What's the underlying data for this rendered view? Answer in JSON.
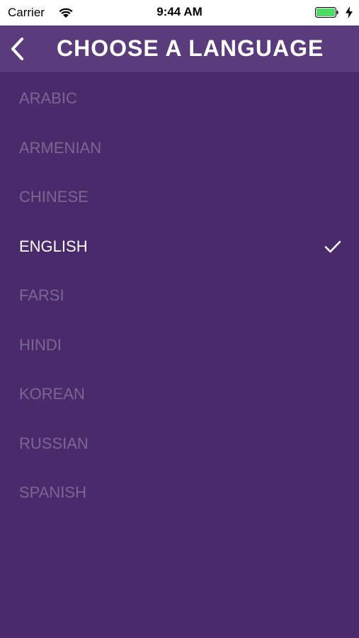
{
  "status_bar": {
    "carrier": "Carrier",
    "time": "9:44 AM",
    "wifi_icon": "wifi-icon",
    "battery_icon": "battery-icon",
    "charging_icon": "charging-bolt-icon"
  },
  "nav": {
    "back_icon": "chevron-left-icon",
    "title": "CHOOSE A LANGUAGE"
  },
  "languages": [
    {
      "label": "ARABIC",
      "selected": false
    },
    {
      "label": "ARMENIAN",
      "selected": false
    },
    {
      "label": "CHINESE",
      "selected": false
    },
    {
      "label": "ENGLISH",
      "selected": true
    },
    {
      "label": "FARSI",
      "selected": false
    },
    {
      "label": "HINDI",
      "selected": false
    },
    {
      "label": "KOREAN",
      "selected": false
    },
    {
      "label": "RUSSIAN",
      "selected": false
    },
    {
      "label": "SPANISH",
      "selected": false
    }
  ],
  "colors": {
    "background": "#4a2a6a",
    "nav_background": "#5a3c7c",
    "unselected_text": "#7a6694",
    "selected_text": "#ffffff",
    "battery_fill": "#4cd964"
  },
  "selected_icon": "checkmark-icon"
}
